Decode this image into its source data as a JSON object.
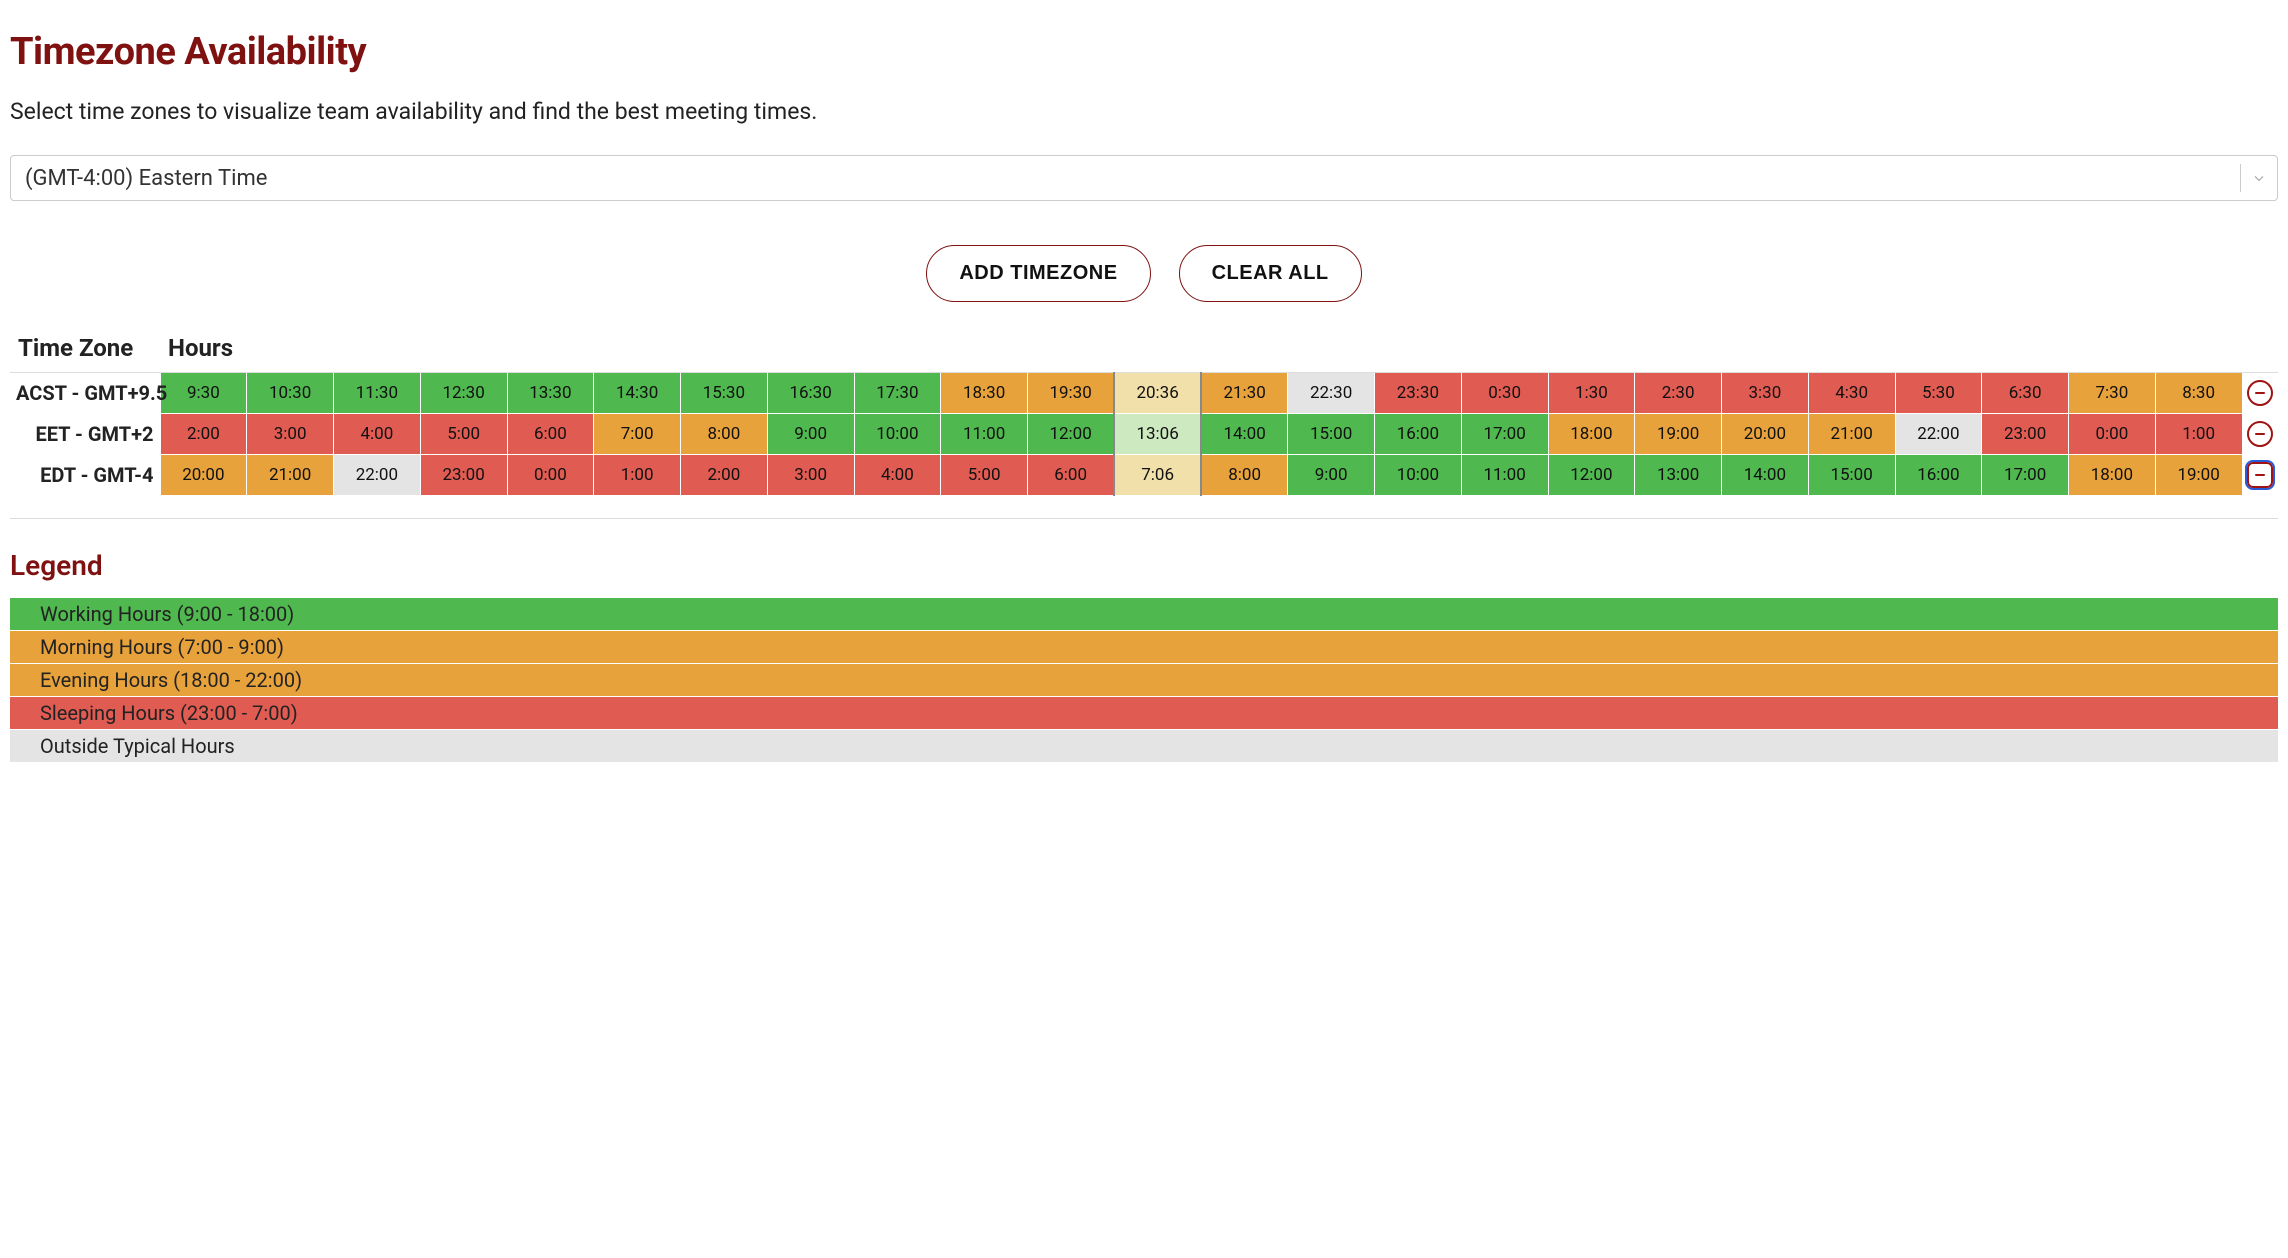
{
  "header": {
    "title": "Timezone Availability",
    "description": "Select time zones to visualize team availability and find the best meeting times."
  },
  "select": {
    "value": "(GMT-4:00) Eastern Time"
  },
  "buttons": {
    "add_label": "ADD TIMEZONE",
    "clear_label": "CLEAR ALL"
  },
  "table": {
    "col_label": "Time Zone",
    "col_hours": "Hours"
  },
  "rows": [
    {
      "id": "acst",
      "label": "ACST - GMT+9.5",
      "focused": false,
      "hours": [
        {
          "t": "9:30",
          "cat": "working"
        },
        {
          "t": "10:30",
          "cat": "working"
        },
        {
          "t": "11:30",
          "cat": "working"
        },
        {
          "t": "12:30",
          "cat": "working"
        },
        {
          "t": "13:30",
          "cat": "working"
        },
        {
          "t": "14:30",
          "cat": "working"
        },
        {
          "t": "15:30",
          "cat": "working"
        },
        {
          "t": "16:30",
          "cat": "working"
        },
        {
          "t": "17:30",
          "cat": "working"
        },
        {
          "t": "18:30",
          "cat": "evening"
        },
        {
          "t": "19:30",
          "cat": "evening"
        },
        {
          "t": "20:36",
          "cat": "now",
          "nowstrong": true
        },
        {
          "t": "21:30",
          "cat": "evening"
        },
        {
          "t": "22:30",
          "cat": "outside"
        },
        {
          "t": "23:30",
          "cat": "sleeping"
        },
        {
          "t": "0:30",
          "cat": "sleeping"
        },
        {
          "t": "1:30",
          "cat": "sleeping"
        },
        {
          "t": "2:30",
          "cat": "sleeping"
        },
        {
          "t": "3:30",
          "cat": "sleeping"
        },
        {
          "t": "4:30",
          "cat": "sleeping"
        },
        {
          "t": "5:30",
          "cat": "sleeping"
        },
        {
          "t": "6:30",
          "cat": "sleeping"
        },
        {
          "t": "7:30",
          "cat": "morning"
        },
        {
          "t": "8:30",
          "cat": "morning"
        }
      ]
    },
    {
      "id": "eet",
      "label": "EET - GMT+2",
      "focused": false,
      "hours": [
        {
          "t": "2:00",
          "cat": "sleeping"
        },
        {
          "t": "3:00",
          "cat": "sleeping"
        },
        {
          "t": "4:00",
          "cat": "sleeping"
        },
        {
          "t": "5:00",
          "cat": "sleeping"
        },
        {
          "t": "6:00",
          "cat": "sleeping"
        },
        {
          "t": "7:00",
          "cat": "morning"
        },
        {
          "t": "8:00",
          "cat": "morning"
        },
        {
          "t": "9:00",
          "cat": "working"
        },
        {
          "t": "10:00",
          "cat": "working"
        },
        {
          "t": "11:00",
          "cat": "working"
        },
        {
          "t": "12:00",
          "cat": "working"
        },
        {
          "t": "13:06",
          "cat": "now"
        },
        {
          "t": "14:00",
          "cat": "working"
        },
        {
          "t": "15:00",
          "cat": "working"
        },
        {
          "t": "16:00",
          "cat": "working"
        },
        {
          "t": "17:00",
          "cat": "working"
        },
        {
          "t": "18:00",
          "cat": "evening"
        },
        {
          "t": "19:00",
          "cat": "evening"
        },
        {
          "t": "20:00",
          "cat": "evening"
        },
        {
          "t": "21:00",
          "cat": "evening"
        },
        {
          "t": "22:00",
          "cat": "outside"
        },
        {
          "t": "23:00",
          "cat": "sleeping"
        },
        {
          "t": "0:00",
          "cat": "sleeping"
        },
        {
          "t": "1:00",
          "cat": "sleeping"
        }
      ]
    },
    {
      "id": "edt",
      "label": "EDT - GMT-4",
      "focused": true,
      "hours": [
        {
          "t": "20:00",
          "cat": "evening"
        },
        {
          "t": "21:00",
          "cat": "evening"
        },
        {
          "t": "22:00",
          "cat": "outside"
        },
        {
          "t": "23:00",
          "cat": "sleeping"
        },
        {
          "t": "0:00",
          "cat": "sleeping"
        },
        {
          "t": "1:00",
          "cat": "sleeping"
        },
        {
          "t": "2:00",
          "cat": "sleeping"
        },
        {
          "t": "3:00",
          "cat": "sleeping"
        },
        {
          "t": "4:00",
          "cat": "sleeping"
        },
        {
          "t": "5:00",
          "cat": "sleeping"
        },
        {
          "t": "6:00",
          "cat": "sleeping"
        },
        {
          "t": "7:06",
          "cat": "now",
          "nowstrong": true
        },
        {
          "t": "8:00",
          "cat": "morning"
        },
        {
          "t": "9:00",
          "cat": "working"
        },
        {
          "t": "10:00",
          "cat": "working"
        },
        {
          "t": "11:00",
          "cat": "working"
        },
        {
          "t": "12:00",
          "cat": "working"
        },
        {
          "t": "13:00",
          "cat": "working"
        },
        {
          "t": "14:00",
          "cat": "working"
        },
        {
          "t": "15:00",
          "cat": "working"
        },
        {
          "t": "16:00",
          "cat": "working"
        },
        {
          "t": "17:00",
          "cat": "working"
        },
        {
          "t": "18:00",
          "cat": "evening"
        },
        {
          "t": "19:00",
          "cat": "evening"
        }
      ]
    }
  ],
  "legend": {
    "title": "Legend",
    "items": [
      {
        "label": "Working Hours (9:00 - 18:00)",
        "cat": "working"
      },
      {
        "label": "Morning Hours (7:00 - 9:00)",
        "cat": "morning"
      },
      {
        "label": "Evening Hours (18:00 - 22:00)",
        "cat": "evening"
      },
      {
        "label": "Sleeping Hours (23:00 - 7:00)",
        "cat": "sleeping"
      },
      {
        "label": "Outside Typical Hours",
        "cat": "outside"
      }
    ]
  }
}
